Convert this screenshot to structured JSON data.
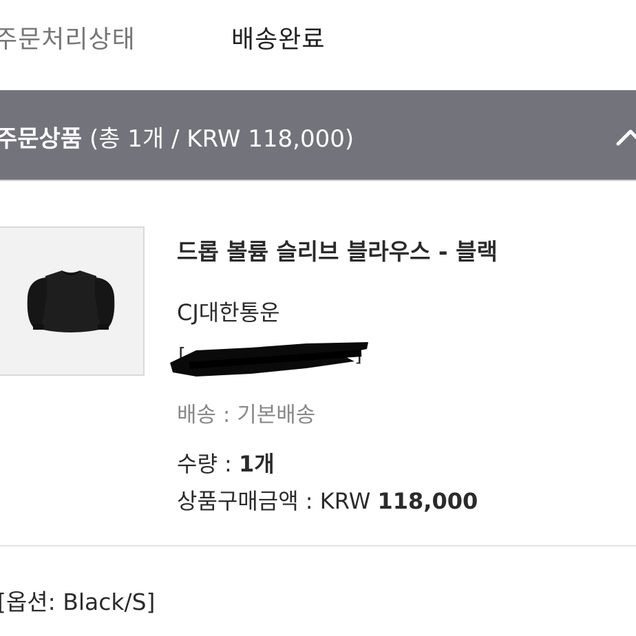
{
  "order_status": {
    "label": "주문처리상태",
    "value": "배송완료"
  },
  "order_items_header": {
    "title": "주문상품",
    "summary": "(총 1개 / KRW 118,000)",
    "toggle_icon": "chevron-up-icon"
  },
  "product": {
    "name": "드롭 볼륨 슬리브 블라우스 - 블랙",
    "courier": "CJ대한통운",
    "tracking_number_redacted": true,
    "shipping_label": "배송 : ",
    "shipping_value": "기본배송",
    "quantity_label": "수량 : ",
    "quantity_value": "1개",
    "amount_label": "상품구매금액 : ",
    "amount_currency": "KRW ",
    "amount_value": "118,000",
    "option": "[옵션: Black/S]"
  },
  "colors": {
    "header_bg": "#73737b",
    "header_text": "#ffffff",
    "muted_text": "#888888"
  }
}
